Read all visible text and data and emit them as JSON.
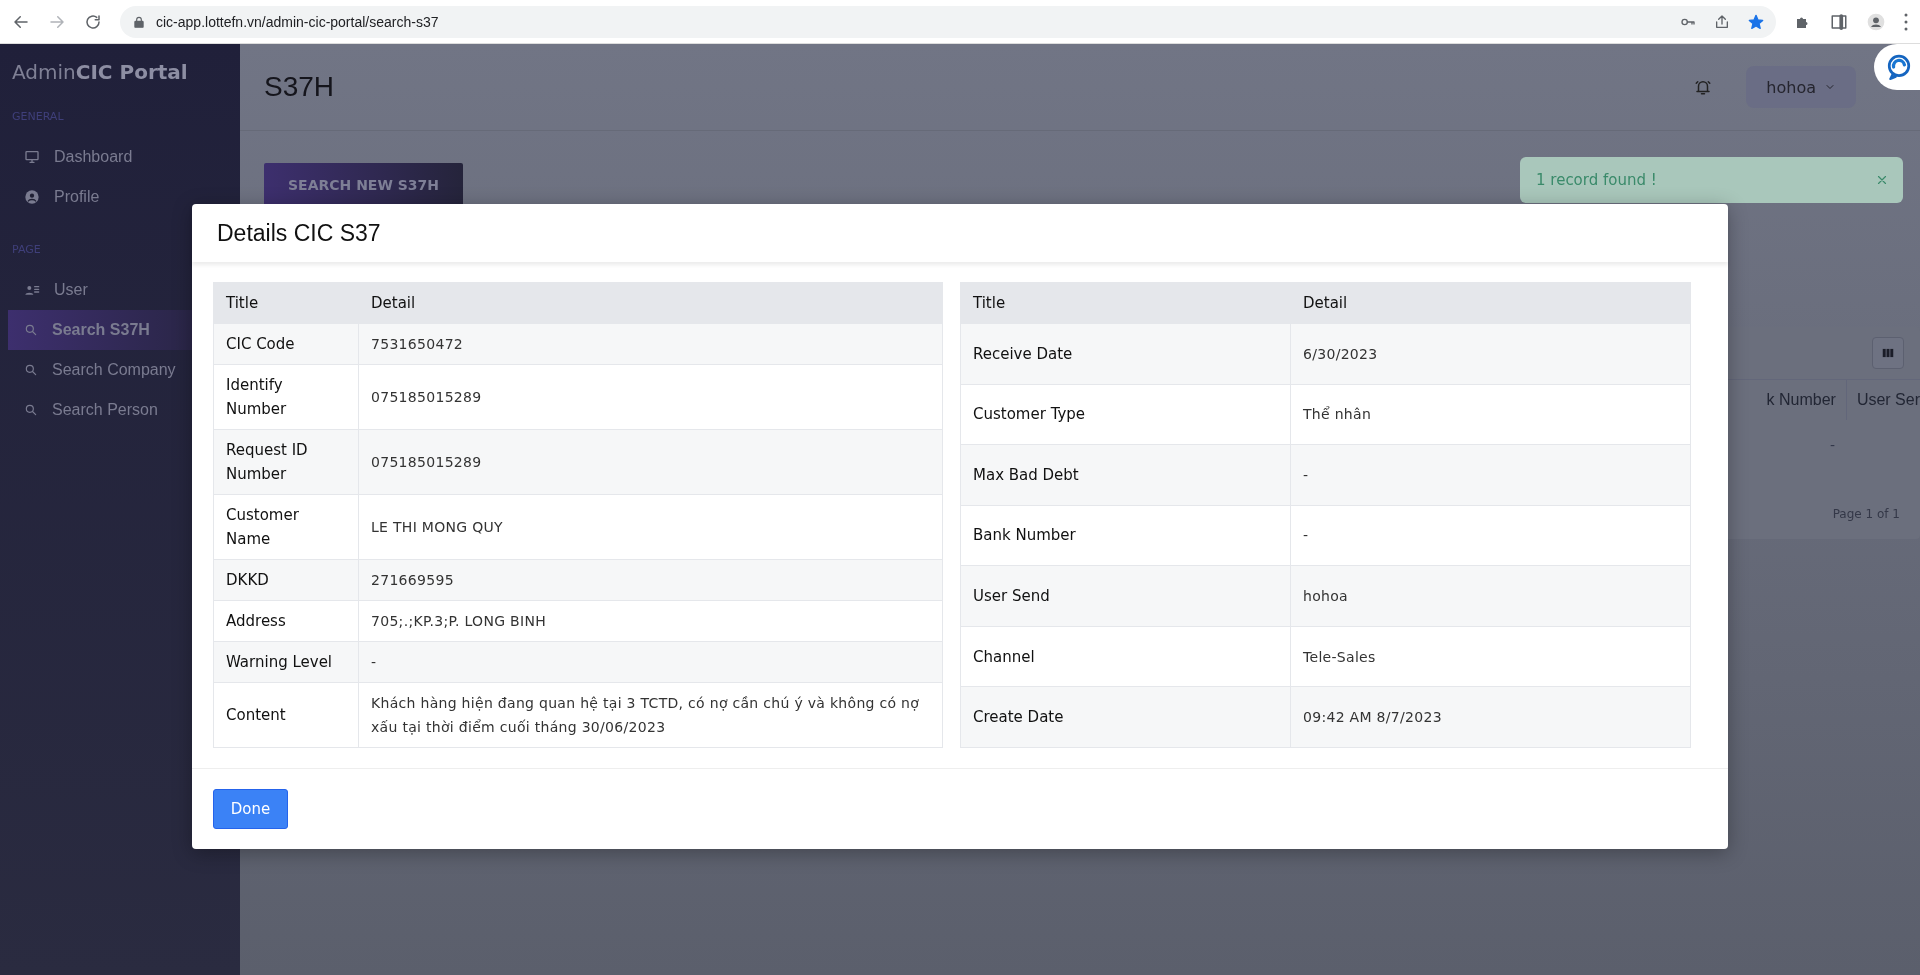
{
  "browser": {
    "url": "cic-app.lottefn.vn/admin-cic-portal/search-s37"
  },
  "sidebar": {
    "brand_light": "Admin",
    "brand_bold": "CIC Portal",
    "sections": [
      {
        "heading": "GENERAL",
        "items": [
          {
            "label": "Dashboard",
            "kind": "monitor",
            "selected": false
          },
          {
            "label": "Profile",
            "kind": "profile",
            "selected": false
          }
        ]
      },
      {
        "heading": "PAGE",
        "items": [
          {
            "label": "User",
            "kind": "users",
            "selected": false
          },
          {
            "label": "Search S37H",
            "kind": "search",
            "selected": true
          },
          {
            "label": "Search Company",
            "kind": "search",
            "selected": false
          },
          {
            "label": "Search Person",
            "kind": "search",
            "selected": false
          }
        ]
      }
    ]
  },
  "header": {
    "title": "S37H",
    "user": "hohoa"
  },
  "search_button": "SEARCH NEW S37H",
  "toast": {
    "message": "1 record found !"
  },
  "background_table": {
    "columns": [
      "k Number",
      "User Ser"
    ],
    "cells": [
      "-"
    ],
    "pagination": "Page 1 of 1"
  },
  "modal": {
    "title": "Details CIC S37",
    "tables": [
      {
        "columns": [
          "Title",
          "Detail"
        ],
        "rows": [
          {
            "title": "CIC Code",
            "detail": "7531650472"
          },
          {
            "title": "Identify Number",
            "detail": "075185015289"
          },
          {
            "title": "Request ID Number",
            "detail": "075185015289"
          },
          {
            "title": "Customer Name",
            "detail": "LE THI MONG QUY"
          },
          {
            "title": "DKKD",
            "detail": "271669595"
          },
          {
            "title": "Address",
            "detail": "705;.;KP.3;P. LONG BINH"
          },
          {
            "title": "Warning Level",
            "detail": "-"
          },
          {
            "title": "Content",
            "detail": "Khách hàng hiện đang quan hệ tại 3 TCTD, có nợ cần chú ý và không có nợ xấu tại thời điểm cuối tháng 30/06/2023"
          }
        ]
      },
      {
        "columns": [
          "Title",
          "Detail"
        ],
        "rows": [
          {
            "title": "Receive Date",
            "detail": "6/30/2023"
          },
          {
            "title": "Customer Type",
            "detail": "Thể nhân"
          },
          {
            "title": "Max Bad Debt",
            "detail": "-"
          },
          {
            "title": "Bank Number",
            "detail": "-"
          },
          {
            "title": "User Send",
            "detail": "hohoa"
          },
          {
            "title": "Channel",
            "detail": "Tele-Sales"
          },
          {
            "title": "Create Date",
            "detail": "09:42 AM 8/7/2023"
          }
        ]
      }
    ],
    "done_button": "Done"
  }
}
